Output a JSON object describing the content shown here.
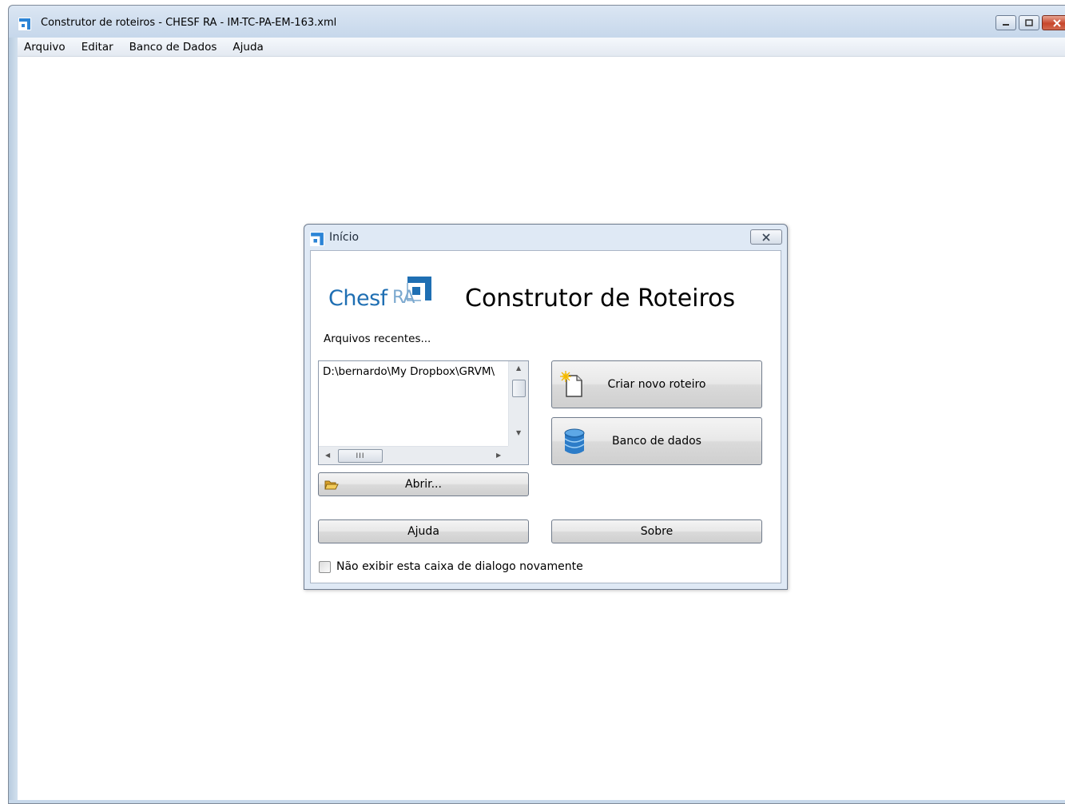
{
  "window": {
    "title": "Construtor de roteiros - CHESF RA - IM-TC-PA-EM-163.xml"
  },
  "menu": [
    "Arquivo",
    "Editar",
    "Banco de Dados",
    "Ajuda"
  ],
  "dialog": {
    "title": "Início",
    "logo_text": "Chesf",
    "logo_ra": "RA",
    "heading": "Construtor de Roteiros",
    "recent_label": "Arquivos recentes...",
    "recent_files": [
      "D:\\bernardo\\My Dropbox\\GRVM\\"
    ],
    "buttons": {
      "new": "Criar novo roteiro",
      "database": "Banco de dados",
      "open": "Abrir...",
      "help": "Ajuda",
      "about": "Sobre"
    },
    "checkbox_label": "Não exibir esta caixa de dialogo novamente",
    "checkbox_checked": false
  },
  "colors": {
    "brand_blue": "#1f6fb3",
    "frame": "#c4d6ea"
  }
}
